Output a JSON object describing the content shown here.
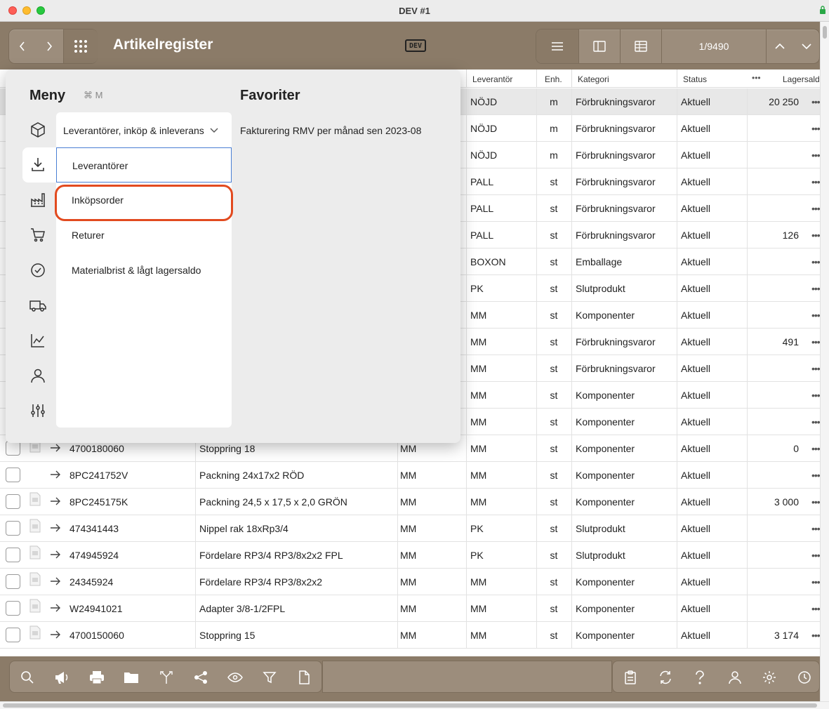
{
  "window": {
    "title": "DEV #1"
  },
  "header": {
    "app_title": "Artikelregister",
    "dev_badge": "DEV",
    "record_count": "1/9490"
  },
  "table": {
    "columns": {
      "leverantor": "Leverantör",
      "enhet": "Enh.",
      "kategori": "Kategori",
      "status": "Status",
      "more": "•••",
      "lagersaldo": "Lagersald"
    },
    "rows": [
      {
        "supplier": "NÖJD",
        "unit": "m",
        "category": "Förbrukningsvaror",
        "status": "Aktuell",
        "stock": "20 250"
      },
      {
        "supplier": "NÖJD",
        "unit": "m",
        "category": "Förbrukningsvaror",
        "status": "Aktuell",
        "stock": ""
      },
      {
        "supplier": "NÖJD",
        "unit": "m",
        "category": "Förbrukningsvaror",
        "status": "Aktuell",
        "stock": ""
      },
      {
        "supplier": "PALL",
        "unit": "st",
        "category": "Förbrukningsvaror",
        "status": "Aktuell",
        "stock": ""
      },
      {
        "supplier": "PALL",
        "unit": "st",
        "category": "Förbrukningsvaror",
        "status": "Aktuell",
        "stock": ""
      },
      {
        "supplier": "PALL",
        "unit": "st",
        "category": "Förbrukningsvaror",
        "status": "Aktuell",
        "stock": "126"
      },
      {
        "supplier": "BOXON",
        "unit": "st",
        "category": "Emballage",
        "status": "Aktuell",
        "stock": ""
      },
      {
        "supplier": "PK",
        "unit": "st",
        "category": "Slutprodukt",
        "status": "Aktuell",
        "stock": ""
      },
      {
        "supplier": "MM",
        "unit": "st",
        "category": "Komponenter",
        "status": "Aktuell",
        "stock": ""
      },
      {
        "supplier": "MM",
        "unit": "st",
        "category": "Förbrukningsvaror",
        "status": "Aktuell",
        "stock": "491"
      },
      {
        "supplier": "MM",
        "unit": "st",
        "category": "Förbrukningsvaror",
        "status": "Aktuell",
        "stock": ""
      },
      {
        "supplier": "MM",
        "unit": "st",
        "category": "Komponenter",
        "status": "Aktuell",
        "stock": ""
      },
      {
        "supplier": "MM",
        "unit": "st",
        "category": "Komponenter",
        "status": "Aktuell",
        "stock": ""
      },
      {
        "article_no": "4700180060",
        "name": "Stoppring 18",
        "group": "MM",
        "supplier": "MM",
        "unit": "st",
        "category": "Komponenter",
        "status": "Aktuell",
        "stock": "0"
      },
      {
        "article_no": "8PC241752V",
        "name": "Packning 24x17x2 RÖD",
        "group": "MM",
        "supplier": "MM",
        "unit": "st",
        "category": "Komponenter",
        "status": "Aktuell",
        "stock": ""
      },
      {
        "article_no": "8PC245175K",
        "name": "Packning 24,5 x 17,5 x 2,0 GRÖN",
        "group": "MM",
        "supplier": "MM",
        "unit": "st",
        "category": "Komponenter",
        "status": "Aktuell",
        "stock": "3 000"
      },
      {
        "article_no": "474341443",
        "name": "Nippel rak 18xRp3/4",
        "group": "MM",
        "supplier": "PK",
        "unit": "st",
        "category": "Slutprodukt",
        "status": "Aktuell",
        "stock": ""
      },
      {
        "article_no": "474945924",
        "name": "Fördelare RP3/4 RP3/8x2x2 FPL",
        "group": "MM",
        "supplier": "PK",
        "unit": "st",
        "category": "Slutprodukt",
        "status": "Aktuell",
        "stock": ""
      },
      {
        "article_no": "24345924",
        "name": "Fördelare RP3/4 RP3/8x2x2",
        "group": "MM",
        "supplier": "MM",
        "unit": "st",
        "category": "Komponenter",
        "status": "Aktuell",
        "stock": ""
      },
      {
        "article_no": "W24941021",
        "name": "Adapter 3/8-1/2FPL",
        "group": "MM",
        "supplier": "MM",
        "unit": "st",
        "category": "Komponenter",
        "status": "Aktuell",
        "stock": ""
      },
      {
        "article_no": "4700150060",
        "name": "Stoppring 15",
        "group": "MM",
        "supplier": "MM",
        "unit": "st",
        "category": "Komponenter",
        "status": "Aktuell",
        "stock": "3 174"
      }
    ]
  },
  "menu": {
    "title": "Meny",
    "shortcut": "⌘ M",
    "favorites_title": "Favoriter",
    "favorites": [
      "Fakturering RMV per månad sen 2023-08"
    ],
    "section_select": "Leverantörer, inköp & inleverans",
    "items": [
      "Leverantörer",
      "Inköpsorder",
      "Returer",
      "Materialbrist & lågt lagersaldo"
    ],
    "sidebar_icons": [
      "box-icon",
      "download-icon",
      "factory-icon",
      "cart-icon",
      "check-circle-icon",
      "truck-icon",
      "chart-icon",
      "user-icon",
      "sliders-icon"
    ]
  },
  "colors": {
    "toolbar": "#8b7b68",
    "highlight": "#e24a1f",
    "focus": "#4a7fd4"
  }
}
